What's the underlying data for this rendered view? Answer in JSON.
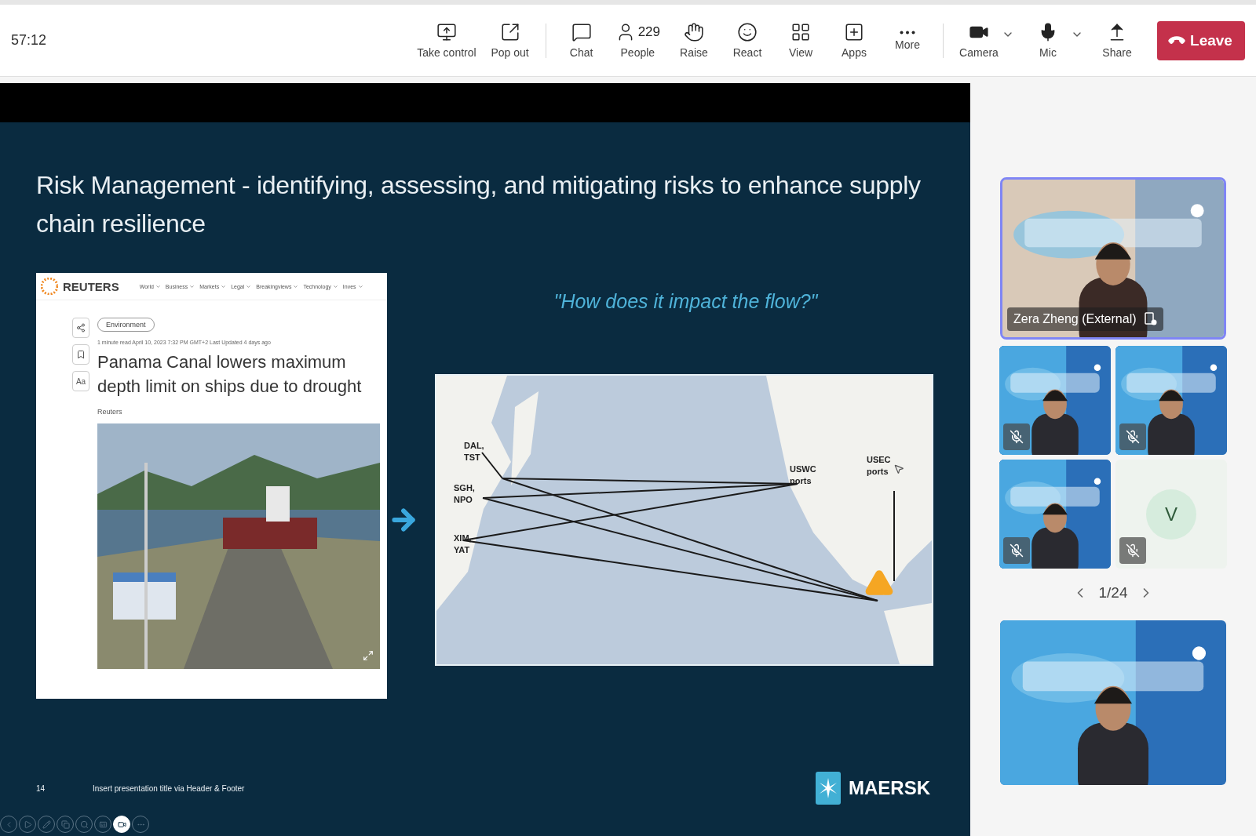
{
  "toolbar": {
    "timer": "57:12",
    "groups": [
      [
        {
          "label": "Take control",
          "dropdown": false
        },
        {
          "label": "Pop out",
          "dropdown": false
        }
      ],
      [
        {
          "label": "Chat",
          "dropdown": false
        },
        {
          "label": "People",
          "count": "229",
          "dropdown": false
        },
        {
          "label": "Raise",
          "dropdown": false
        },
        {
          "label": "React",
          "dropdown": false
        },
        {
          "label": "View",
          "dropdown": false
        },
        {
          "label": "Apps",
          "dropdown": false
        },
        {
          "label": "More",
          "dropdown": false
        }
      ],
      [
        {
          "label": "Camera",
          "dropdown": true
        },
        {
          "label": "Mic",
          "dropdown": true
        },
        {
          "label": "Share",
          "dropdown": false
        }
      ]
    ],
    "leave": "Leave"
  },
  "slide": {
    "title": "Risk Management - identifying, assessing, and mitigating risks to enhance supply chain resilience",
    "article": {
      "source": "REUTERS",
      "nav": [
        "World",
        "Business",
        "Markets",
        "Legal",
        "Breakingviews",
        "Technology",
        "Inves"
      ],
      "tag": "Environment",
      "meta": "1 minute read  April 10, 2023 7:32 PM GMT+2  Last Updated 4 days ago",
      "side_actions": [
        "Aa"
      ],
      "headline": "Panama Canal lowers maximum depth limit on ships due to drought",
      "byline": "Reuters",
      "photo": {
        "kind": "picture"
      }
    },
    "quote": "\"How does it impact the flow?\"",
    "map_labels": [
      "DAL, TST",
      "SGH, NPO",
      "XIM, YAT",
      "USWC ports",
      "USEC ports"
    ],
    "logo": "MAERSK",
    "footer": {
      "page": "14",
      "text": "Insert presentation title via Header & Footer"
    }
  },
  "participants": {
    "featured": {
      "name": "Zera Zheng (External)",
      "selected": true
    },
    "tiles": [
      {
        "kind": "video",
        "muted": true
      },
      {
        "kind": "video",
        "muted": true
      },
      {
        "kind": "video",
        "muted": true
      },
      {
        "kind": "avatar",
        "initial": "V",
        "muted": true
      }
    ],
    "pager": "1/24",
    "shared": {
      "kind": "video"
    }
  }
}
